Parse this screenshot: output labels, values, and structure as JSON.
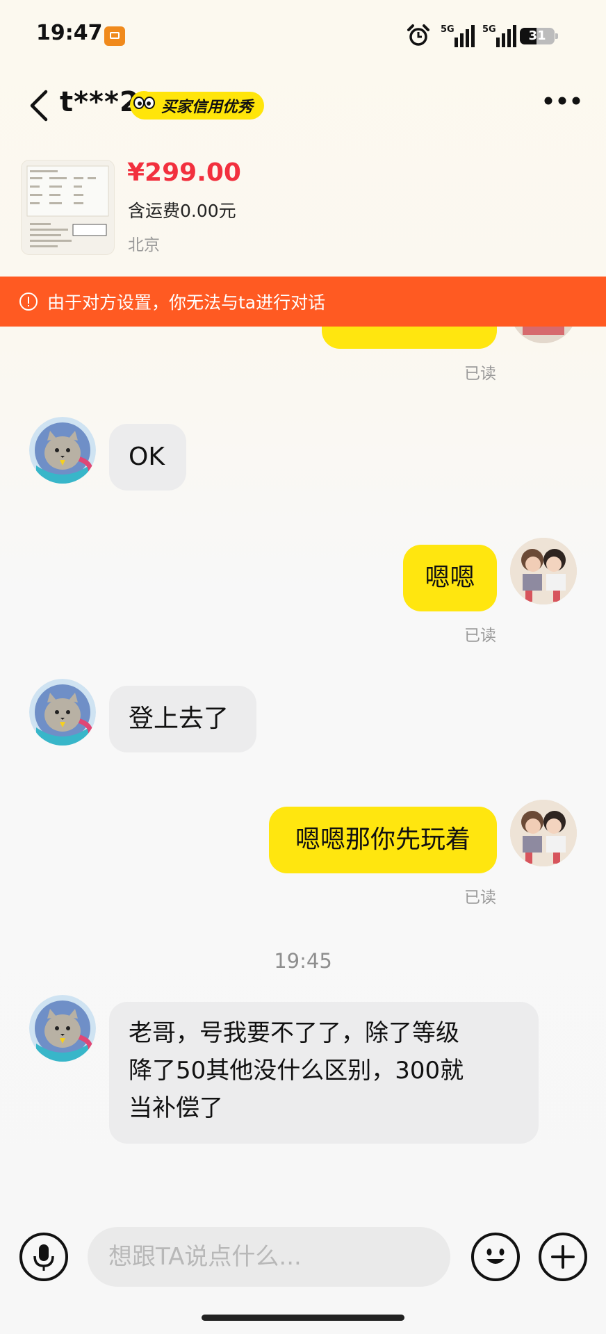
{
  "status_bar": {
    "time": "19:47",
    "battery": "31",
    "network": [
      "5G",
      "5G"
    ]
  },
  "header": {
    "name": "t***2",
    "credit_badge": "买家信用优秀"
  },
  "product": {
    "price": "¥299.00",
    "shipping": "含运费0.00元",
    "location": "北京"
  },
  "banner": {
    "text": "由于对方设置，你无法与ta进行对话"
  },
  "messages": [
    {
      "from": "me",
      "read": "已读"
    },
    {
      "from": "them",
      "text": "OK"
    },
    {
      "from": "me",
      "text": "嗯嗯",
      "read": "已读"
    },
    {
      "from": "them",
      "text": "登上去了"
    },
    {
      "from": "me",
      "text": "嗯嗯那你先玩着",
      "read": "已读"
    },
    {
      "from": "time",
      "text": "19:45"
    },
    {
      "from": "them",
      "lines": [
        "老哥，号我要不了了，除了等级",
        "降了50其他没什么区别，300就",
        "当补偿了"
      ]
    }
  ],
  "input": {
    "placeholder": "想跟TA说点什么..."
  },
  "colors": {
    "accent": "#ffe60f",
    "banner": "#ff5a22",
    "price": "#f2303e"
  }
}
